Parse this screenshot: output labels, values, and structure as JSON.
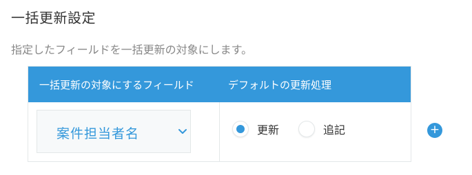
{
  "page": {
    "title": "一括更新設定",
    "description": "指定したフィールドを一括更新の対象にします。"
  },
  "table": {
    "headers": [
      "一括更新の対象にするフィールド",
      "デフォルトの更新処理"
    ],
    "rows": [
      {
        "field_select": {
          "value": "案件担当者名",
          "icon": "chevron-down-icon"
        },
        "update_options": [
          {
            "label": "更新",
            "checked": true
          },
          {
            "label": "追記",
            "checked": false
          }
        ]
      }
    ]
  },
  "add_row": {
    "icon": "plus-icon",
    "label": "+"
  },
  "colors": {
    "accent": "#3498db",
    "border": "#e3e7e8",
    "muted_text": "#888888"
  }
}
